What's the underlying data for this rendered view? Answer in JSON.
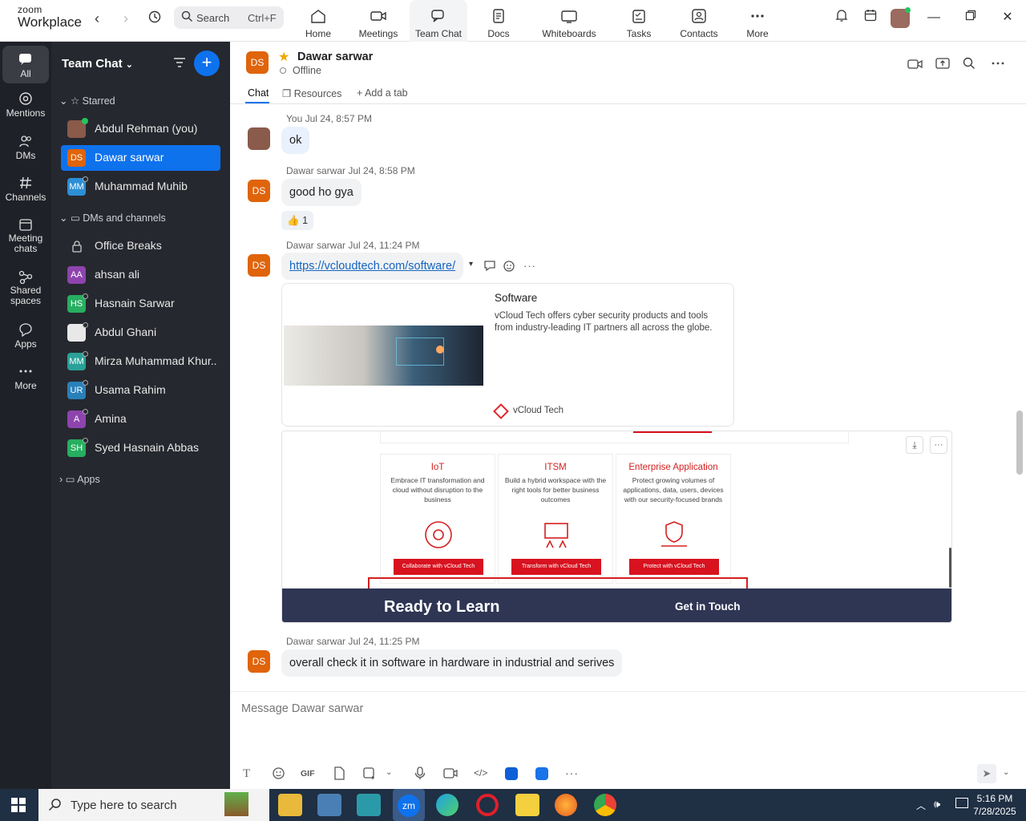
{
  "app": {
    "logo_line1": "zoom",
    "logo_line2": "Workplace"
  },
  "search": {
    "label": "Search",
    "shortcut": "Ctrl+F"
  },
  "nav_tabs": [
    {
      "label": "Home",
      "icon": "home-icon"
    },
    {
      "label": "Meetings",
      "icon": "video-icon"
    },
    {
      "label": "Team Chat",
      "icon": "chat-icon",
      "active": true
    },
    {
      "label": "Docs",
      "icon": "doc-icon"
    },
    {
      "label": "Whiteboards",
      "icon": "whiteboard-icon"
    },
    {
      "label": "Tasks",
      "icon": "tasks-icon"
    },
    {
      "label": "Contacts",
      "icon": "contacts-icon"
    },
    {
      "label": "More",
      "icon": "more-icon"
    }
  ],
  "rail": [
    {
      "label": "All",
      "icon": "chat-icon",
      "active": true
    },
    {
      "label": "Mentions",
      "icon": "at-icon"
    },
    {
      "label": "DMs",
      "icon": "people-icon"
    },
    {
      "label": "Channels",
      "icon": "hash-icon"
    },
    {
      "label": "Meeting chats",
      "icon": "calendar-icon"
    },
    {
      "label": "Shared spaces",
      "icon": "shared-icon"
    },
    {
      "label": "Apps",
      "icon": "apps-icon"
    },
    {
      "label": "More",
      "icon": "more-icon"
    }
  ],
  "sidebar": {
    "title": "Team Chat",
    "starred_label": "Starred",
    "starred": [
      {
        "initials": "",
        "name": "Abdul Rehman (you)",
        "color": "#8a5a4a"
      },
      {
        "initials": "DS",
        "name": "Dawar sarwar",
        "color": "#e0640a",
        "selected": true
      },
      {
        "initials": "MM",
        "name": "Muhammad Muhib",
        "color": "#2d8fd5"
      }
    ],
    "dms_label": "DMs and channels",
    "dms": [
      {
        "initials": "",
        "name": "Office Breaks",
        "color": "",
        "lock": true
      },
      {
        "initials": "AA",
        "name": "ahsan ali",
        "color": "#8e44ad"
      },
      {
        "initials": "HS",
        "name": "Hasnain Sarwar",
        "color": "#27ae60"
      },
      {
        "initials": "",
        "name": "Abdul Ghani",
        "color": "#666666"
      },
      {
        "initials": "MM",
        "name": "Mirza Muhammad Khur...",
        "color": "#2aa198"
      },
      {
        "initials": "UR",
        "name": "Usama Rahim",
        "color": "#2980b9"
      },
      {
        "initials": "A",
        "name": "Amina",
        "color": "#8e44ad"
      },
      {
        "initials": "SH",
        "name": "Syed Hasnain Abbas",
        "color": "#27ae60"
      }
    ],
    "apps_label": "Apps"
  },
  "chat": {
    "initials": "DS",
    "name": "Dawar sarwar",
    "status": "Offline",
    "tabs": {
      "chat": "Chat",
      "resources": "Resources",
      "add": "Add a tab"
    }
  },
  "messages": {
    "m1": {
      "meta": "You Jul 24, 8:57 PM",
      "text": "ok"
    },
    "m2": {
      "meta": "Dawar sarwar Jul 24, 8:58 PM",
      "text": "good ho gya",
      "reaction": "👍",
      "reaction_count": "1"
    },
    "m3": {
      "meta": "Dawar sarwar Jul 24, 11:24 PM",
      "link": "https://vcloudtech.com/software/"
    },
    "card": {
      "title": "Software",
      "desc": "vCloud Tech offers cyber security products and tools from industry-leading IT partners all across the globe.",
      "site": "vCloud Tech"
    },
    "shot": {
      "services": [
        {
          "title": "IoT",
          "desc": "Embrace IT transformation and cloud without disruption to the business",
          "button": "Collaborate with vCloud Tech"
        },
        {
          "title": "ITSM",
          "desc": "Build a hybrid workspace with the right tools for better business outcomes",
          "button": "Transform with vCloud Tech"
        },
        {
          "title": "Enterprise Application",
          "desc": "Protect growing volumes of applications, data, users, devices with our security-focused brands",
          "button": "Protect with vCloud Tech"
        }
      ],
      "banner_left": "Ready to Learn",
      "banner_right": "Get in Touch"
    },
    "m4": {
      "meta": "Dawar sarwar Jul 24, 11:25 PM",
      "text": "overall check it in software in hardware in industrial and serives"
    }
  },
  "composer": {
    "placeholder": "Message Dawar sarwar",
    "gif": "GIF"
  },
  "taskbar": {
    "search": "Type here to search",
    "time": "5:16 PM",
    "date": "7/28/2025"
  }
}
